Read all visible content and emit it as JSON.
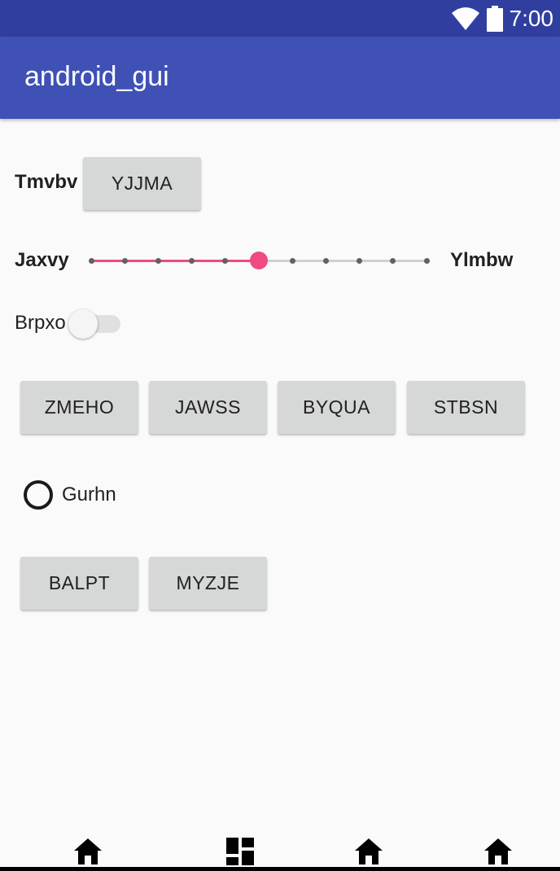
{
  "status_bar": {
    "time": "7:00",
    "icons": [
      "wifi-icon",
      "battery-icon"
    ]
  },
  "app_bar": {
    "title": "android_gui"
  },
  "row1": {
    "label": "Tmvbv",
    "button": "YJJMA"
  },
  "slider": {
    "left_label": "Jaxvy",
    "right_label": "Ylmbw",
    "steps": 10,
    "value": 5,
    "accent": "#ef4a81"
  },
  "switch": {
    "label": "Brpxo",
    "checked": false
  },
  "button_row": {
    "buttons": [
      "ZMEHO",
      "JAWSS",
      "BYQUA",
      "STBSN"
    ]
  },
  "radio": {
    "label": "Gurhn",
    "checked": false
  },
  "button_row2": {
    "buttons": [
      "BALPT",
      "MYZJE"
    ]
  },
  "nav_bar": {
    "icons": [
      "home-icon",
      "dashboard-icon",
      "home-icon",
      "home-icon"
    ]
  },
  "colors": {
    "status_bar": "#303f9f",
    "app_bar": "#3f51b5",
    "accent": "#ef4a81",
    "button": "#d6d7d7"
  }
}
